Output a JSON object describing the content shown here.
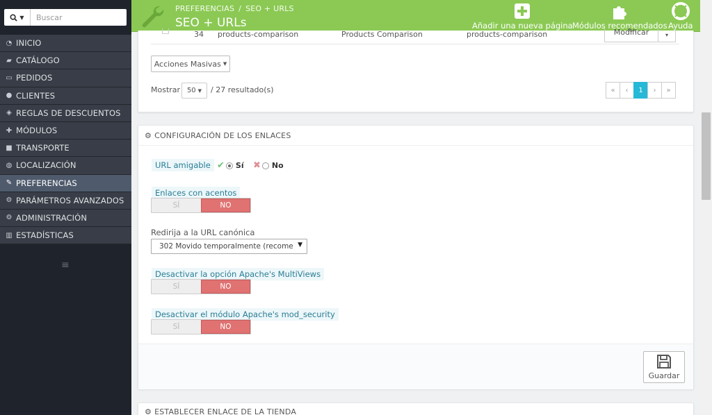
{
  "search": {
    "placeholder": "Buscar"
  },
  "sidebar": {
    "items": [
      {
        "label": "INICIO",
        "icon": "tachometer-icon"
      },
      {
        "label": "CATÁLOGO",
        "icon": "book-icon"
      },
      {
        "label": "PEDIDOS",
        "icon": "credit-card-icon"
      },
      {
        "label": "CLIENTES",
        "icon": "users-icon"
      },
      {
        "label": "REGLAS DE DESCUENTOS",
        "icon": "tags-icon"
      },
      {
        "label": "MÓDULOS",
        "icon": "puzzle-icon"
      },
      {
        "label": "TRANSPORTE",
        "icon": "truck-icon"
      },
      {
        "label": "LOCALIZACIÓN",
        "icon": "globe-icon"
      },
      {
        "label": "PREFERENCIAS",
        "icon": "wrench-icon",
        "active": true
      },
      {
        "label": "PARÁMETROS AVANZADOS",
        "icon": "cogs-icon"
      },
      {
        "label": "ADMINISTRACIÓN",
        "icon": "gear-icon"
      },
      {
        "label": "ESTADÍSTICAS",
        "icon": "bar-chart-icon"
      }
    ]
  },
  "header": {
    "breadcrumb": [
      "PREFERENCIAS",
      "SEO + URLS"
    ],
    "title": "SEO + URLs",
    "buttons": {
      "add_page": "Añadir una nueva página",
      "modules": "Módulos recomendados",
      "help": "Ayuda"
    }
  },
  "list": {
    "partial_row": {
      "id": "34",
      "page": "products-comparison",
      "title": "Products Comparison",
      "rewrite": "products-comparison",
      "action": "Modificar"
    },
    "bulk_actions": "Acciones Masivas",
    "show_label": "Mostrar",
    "per_page": "50",
    "results": "/ 27 resultado(s)",
    "pagination": {
      "first": "«",
      "prev": "‹",
      "current": "1",
      "next": "›",
      "last": "»"
    }
  },
  "links_config": {
    "title": "CONFIGURACIÓN DE LOS ENLACES",
    "friendly_url": {
      "label": "URL amigable",
      "yes": "Sí",
      "no": "No",
      "value": "yes"
    },
    "accented": {
      "label": "Enlaces con acentos",
      "yes": "SÍ",
      "no": "NO",
      "value": "no"
    },
    "canonical": {
      "label": "Redirija a la URL canónica",
      "value": "302 Movido temporalmente (recome"
    },
    "multiviews": {
      "label": "Desactivar la opción Apache's MultiViews",
      "yes": "SÍ",
      "no": "NO",
      "value": "no"
    },
    "mod_security": {
      "label": "Desactivar el módulo Apache's mod_security",
      "yes": "SÍ",
      "no": "NO",
      "value": "no"
    },
    "save": "Guardar"
  },
  "shop_link": {
    "title": "ESTABLECER ENLACE DE LA TIENDA"
  },
  "colors": {
    "header_green": "#8bc954",
    "sidebar_bg": "#1f232b",
    "accent_blue": "#25b9d7",
    "no_red": "#e07272"
  }
}
